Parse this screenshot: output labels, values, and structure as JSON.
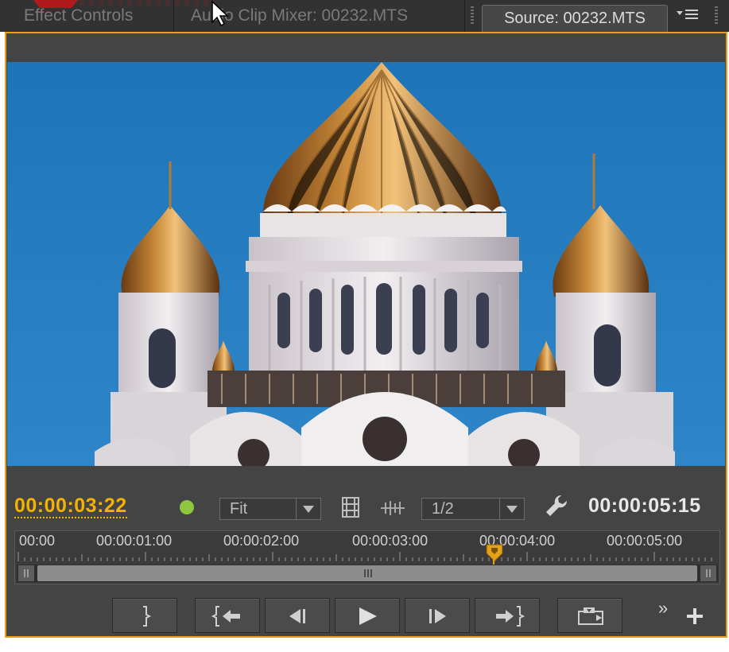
{
  "tabs": {
    "effect_controls": "Effect Controls",
    "audio_clip_mixer": "Audio Clip Mixer: 00232.MTS",
    "source": "Source: 00232.MTS"
  },
  "monitor": {
    "current_timecode": "00:00:03:22",
    "duration_timecode": "00:00:05:15",
    "zoom_select": "Fit",
    "resolution_select": "1/2"
  },
  "ruler": {
    "labels": [
      "00:00",
      "00:00:01:00",
      "00:00:02:00",
      "00:00:03:00",
      "00:00:04:00",
      "00:00:05:00"
    ]
  },
  "transport": {
    "buttons": [
      "mark-in",
      "go-to-in",
      "step-back",
      "play",
      "step-forward",
      "go-to-out",
      "export-frame"
    ]
  },
  "colors": {
    "accent": "#e3a21a",
    "current_timecode": "#f5b300",
    "status_dot": "#8dc63f",
    "panel": "#444444"
  },
  "icons": {
    "panel_menu": "panel-menu-icon",
    "film": "film-icon",
    "audio_waveform": "audio-waveform-icon",
    "wrench": "wrench-icon",
    "add": "plus-icon",
    "overflow": "chevron-double-right-icon"
  }
}
